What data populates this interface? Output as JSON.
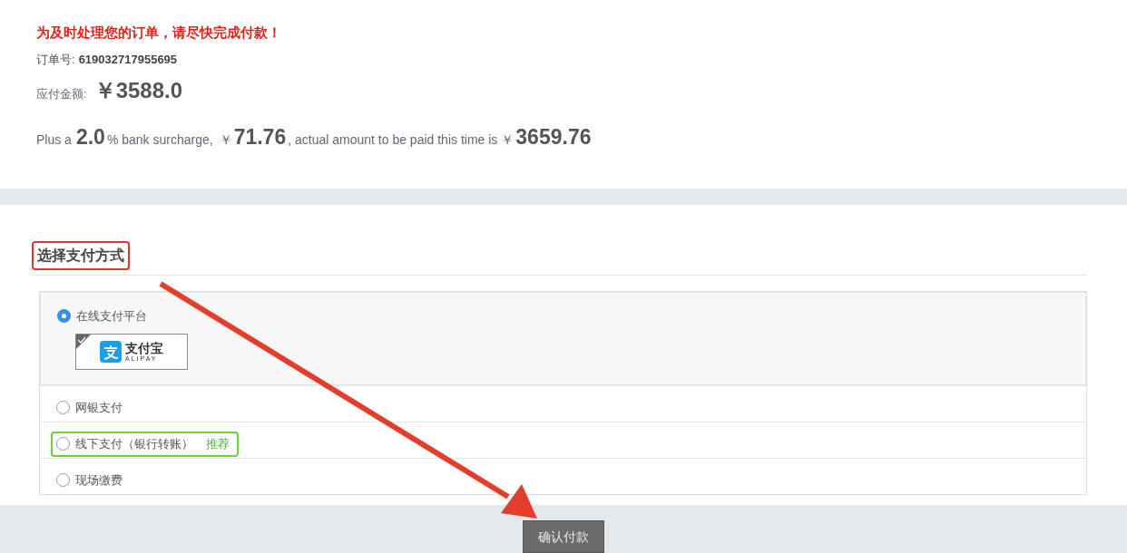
{
  "notice": "为及时处理您的订单，请尽快完成付款！",
  "order": {
    "label": "订单号:",
    "value": "619032717955695"
  },
  "amount": {
    "label": "应付金额:",
    "value": "￥3588.0"
  },
  "surcharge": [
    {
      "kind": "text",
      "text": "Plus a"
    },
    {
      "kind": "number",
      "text": "2.0"
    },
    {
      "kind": "text",
      "text": "% bank surcharge,"
    },
    {
      "kind": "currency",
      "text": "￥"
    },
    {
      "kind": "number",
      "text": "71.76"
    },
    {
      "kind": "text",
      "text": ", actual amount to be paid this time is"
    },
    {
      "kind": "currency",
      "text": "￥"
    },
    {
      "kind": "number",
      "text": "3659.76"
    }
  ],
  "payment": {
    "heading": "选择支付方式",
    "heading_highlighted": true,
    "options": [
      {
        "label": "在线支付平台",
        "selected": true,
        "highlighted": false,
        "platforms": [
          {
            "label": "支付宝",
            "sublabel": "ALIPAY",
            "selected": true
          }
        ]
      },
      {
        "label": "网银支付",
        "selected": false,
        "highlighted": false
      },
      {
        "label": "线下支付（银行转账）",
        "tag": "推荐",
        "selected": false,
        "highlighted": true
      },
      {
        "label": "现场缴费",
        "selected": false,
        "highlighted": false
      }
    ]
  },
  "confirm_button": "确认付款"
}
